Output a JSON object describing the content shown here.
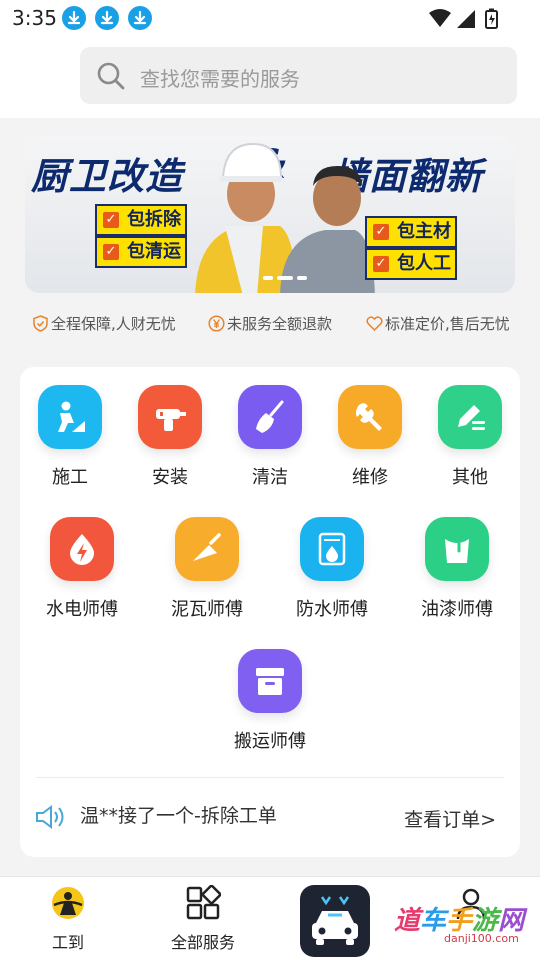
{
  "status_bar": {
    "time": "3:35",
    "notification_icons": [
      "download-icon",
      "download-icon",
      "download-icon"
    ],
    "system_icons": [
      "wifi-icon",
      "signal-icon",
      "battery-icon"
    ]
  },
  "search": {
    "placeholder": "查找您需要的服务"
  },
  "banner": {
    "title_left": "厨卫改造",
    "ampersand": "&",
    "title_right": "墙面翻新",
    "tags_left": [
      "包拆除",
      "包清运"
    ],
    "tags_right": [
      "包主材",
      "包人工"
    ]
  },
  "assurances": [
    {
      "icon": "shield-check-icon",
      "text": "全程保障,人财无忧"
    },
    {
      "icon": "yuan-icon",
      "text": "未服务全额退款"
    },
    {
      "icon": "heart-icon",
      "text": "标准定价,售后无忧"
    }
  ],
  "services_row1": [
    {
      "label": "施工",
      "icon": "construction-worker-icon",
      "color": "#1db8f0"
    },
    {
      "label": "安装",
      "icon": "drill-icon",
      "color": "#f25a3a"
    },
    {
      "label": "清洁",
      "icon": "broom-icon",
      "color": "#7b5cf0"
    },
    {
      "label": "维修",
      "icon": "wrench-icon",
      "color": "#f7a928"
    },
    {
      "label": "其他",
      "icon": "edit-list-icon",
      "color": "#2fd08a"
    }
  ],
  "services_row2": [
    {
      "label": "水电师傅",
      "icon": "water-electric-icon",
      "color": "#f2563c"
    },
    {
      "label": "泥瓦师傅",
      "icon": "trowel-icon",
      "color": "#f7ac2c"
    },
    {
      "label": "防水师傅",
      "icon": "waterproof-icon",
      "color": "#1ab3ef"
    },
    {
      "label": "油漆师傅",
      "icon": "paint-bucket-icon",
      "color": "#2ccf86"
    }
  ],
  "services_row3": [
    {
      "label": "搬运师傅",
      "icon": "box-icon",
      "color": "#8060f0"
    }
  ],
  "notice": {
    "text": "温**接了一个-拆除工单",
    "link": "查看订单>"
  },
  "tabbar": {
    "tabs": [
      {
        "label": "工到",
        "icon": "gongdao-logo-icon"
      },
      {
        "label": "全部服务",
        "icon": "grid-icon"
      }
    ],
    "center_icon": "car-service-icon",
    "profile_icon": "user-icon"
  },
  "watermark": {
    "chars": [
      "道",
      "车",
      "手",
      "游",
      "网"
    ],
    "url": "danji100.com"
  }
}
